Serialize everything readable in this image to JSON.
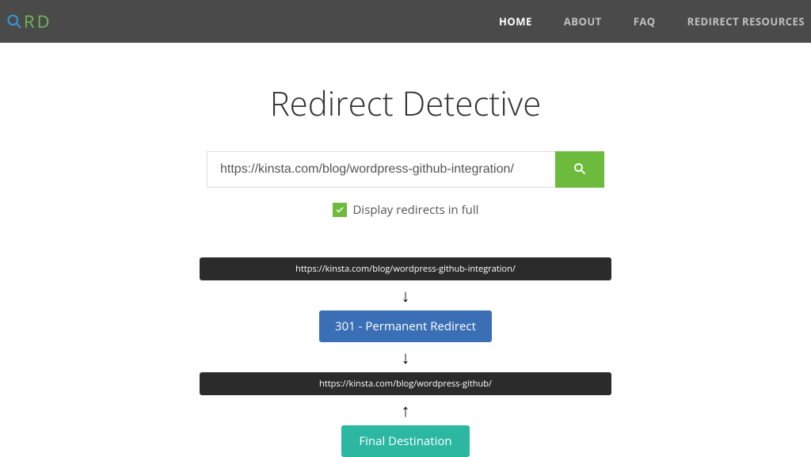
{
  "logo": {
    "r": "R",
    "d": "D"
  },
  "nav": {
    "home": "HOME",
    "about": "ABOUT",
    "faq": "FAQ",
    "resources": "REDIRECT RESOURCES"
  },
  "title": "Redirect Detective",
  "search": {
    "value": "https://kinsta.com/blog/wordpress-github-integration/"
  },
  "checkbox": {
    "label": "Display redirects in full"
  },
  "flow": {
    "url1": "https://kinsta.com/blog/wordpress-github-integration/",
    "status": "301 - Permanent Redirect",
    "url2": "https://kinsta.com/blog/wordpress-github/",
    "destination": "Final Destination"
  }
}
